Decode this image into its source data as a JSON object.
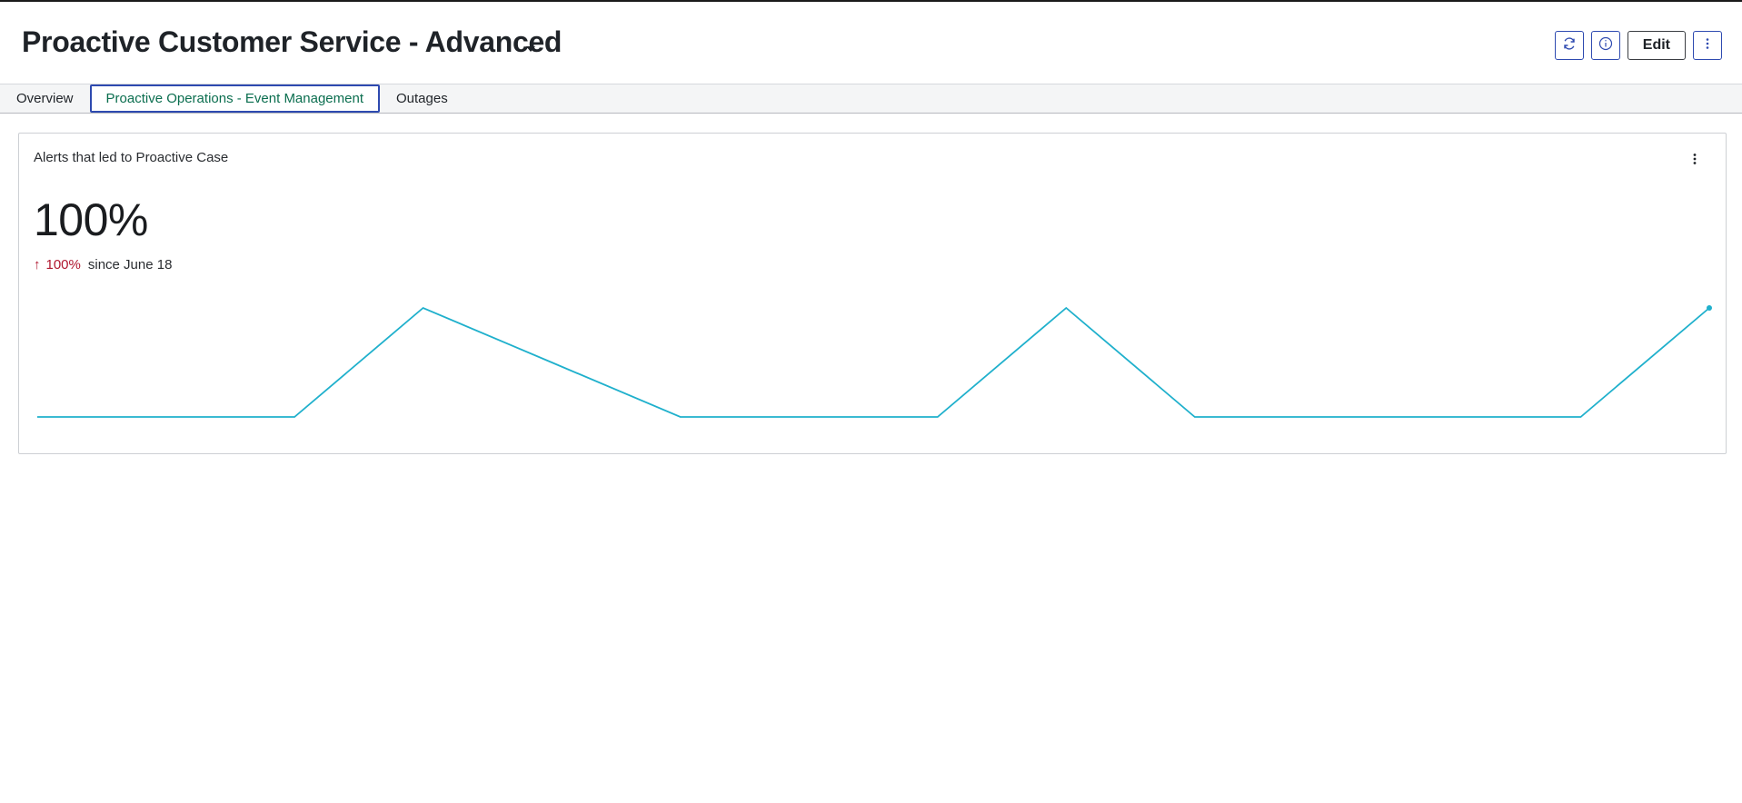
{
  "header": {
    "title": "Proactive Customer Service - Advanced",
    "edit_label": "Edit",
    "icons": [
      "refresh-icon",
      "info-icon",
      "more-vertical-icon",
      "chevron-down-icon"
    ]
  },
  "tabs": [
    {
      "label": "Overview",
      "active": false
    },
    {
      "label": "Proactive Operations - Event Management",
      "active": true
    },
    {
      "label": "Outages",
      "active": false
    }
  ],
  "widget": {
    "title": "Alerts that led to Proactive Case",
    "value": "100%",
    "trend_arrow": "↑",
    "trend_percent": "100%",
    "trend_text": "since June 18"
  },
  "colors": {
    "accent_blue": "#2e4ab0",
    "active_tab_text": "#0b6e4f",
    "trend_red": "#b0172f",
    "line": "#1fb0cc"
  },
  "chart_data": {
    "type": "line",
    "x": [
      1,
      2,
      3,
      4,
      5,
      6,
      7,
      8,
      9,
      10,
      11,
      12,
      13,
      14
    ],
    "series": [
      {
        "values": [
          0,
          0,
          0,
          1,
          0.5,
          0,
          0,
          0,
          1,
          0,
          0,
          0,
          0,
          1
        ]
      }
    ],
    "ylim": [
      0,
      1
    ],
    "grid": false,
    "legend": "none"
  }
}
